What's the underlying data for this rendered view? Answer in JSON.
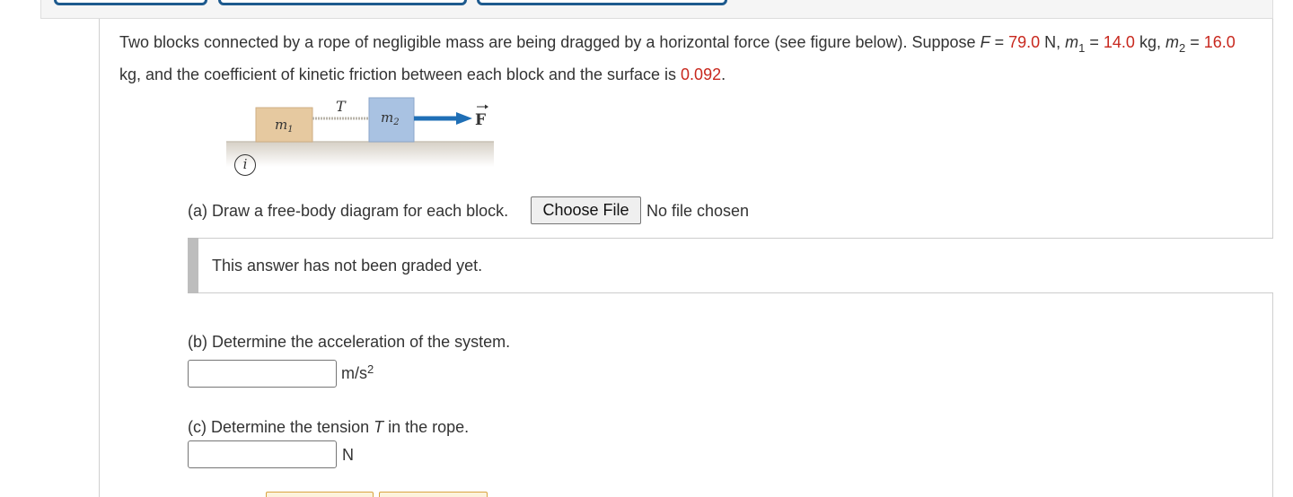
{
  "problem": {
    "text_before_F": "Two blocks connected by a rope of negligible mass are being dragged by a horizontal force (see figure below). Suppose ",
    "F_symbol": "F",
    "eq1": " = ",
    "F_value": "79.0",
    "F_unit": " N, ",
    "m1_symbol": "m",
    "m1_sub": "1",
    "eq2": " = ",
    "m1_value": "14.0",
    "m1_unit": " kg, ",
    "m2_symbol": "m",
    "m2_sub": "2",
    "eq3": " = ",
    "m2_value": "16.0",
    "m2_unit": " kg, and the coefficient of kinetic friction between each block and the surface is ",
    "mu_value": "0.092",
    "end": "."
  },
  "figure": {
    "block1_label": "m",
    "block1_sub": "1",
    "block2_label": "m",
    "block2_sub": "2",
    "tension_label": "T",
    "force_label": "F",
    "colors": {
      "block1": "#e6c9a0",
      "block2": "#a9c2e2",
      "arrow": "#1f6fb6",
      "rope": "#b9b4aa",
      "surface": "#d8d2c8"
    },
    "info_icon": "info-icon"
  },
  "part_a": {
    "question": "(a) Draw a free-body diagram for each block.",
    "choose_button": "Choose File",
    "file_status": "No file chosen",
    "graded_message": "This answer has not been graded yet."
  },
  "part_b": {
    "question": "(b) Determine the acceleration of the system.",
    "input_value": "",
    "unit_base": "m/s",
    "unit_exp": "2"
  },
  "part_c": {
    "question_prefix": "(c) Determine the tension ",
    "question_var": "T",
    "question_suffix": " in the rope.",
    "input_value": "",
    "unit": "N"
  }
}
